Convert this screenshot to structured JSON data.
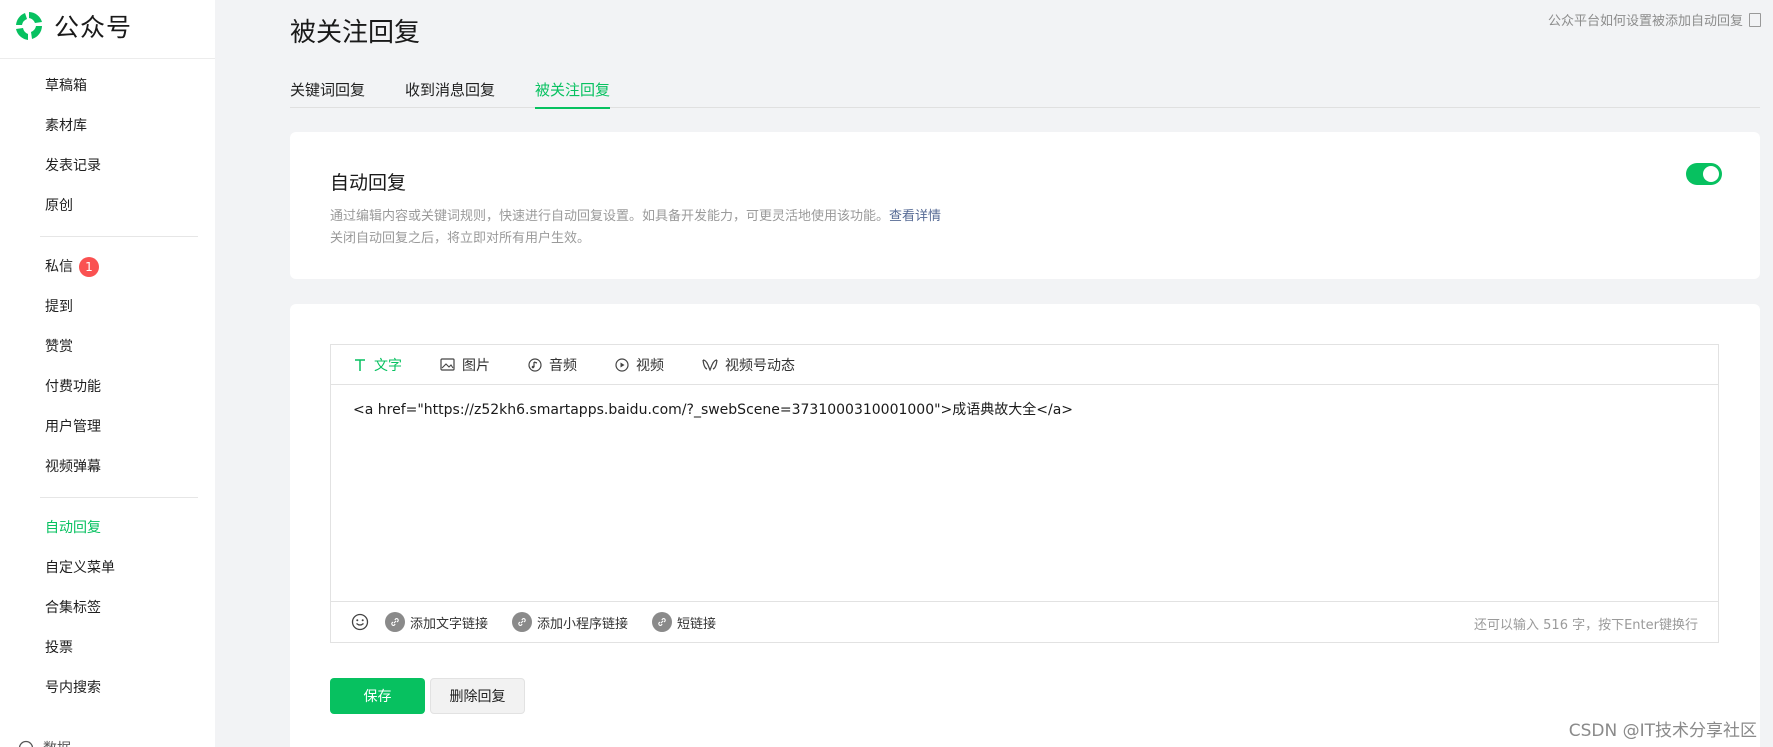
{
  "brand": {
    "name": "公众号",
    "accent": "#07c160"
  },
  "sidebar": {
    "group1": [
      {
        "label": "草稿箱"
      },
      {
        "label": "素材库"
      },
      {
        "label": "发表记录"
      },
      {
        "label": "原创"
      }
    ],
    "group2": [
      {
        "label": "私信",
        "badge": "1"
      },
      {
        "label": "提到"
      },
      {
        "label": "赞赏"
      },
      {
        "label": "付费功能"
      },
      {
        "label": "用户管理"
      },
      {
        "label": "视频弹幕"
      }
    ],
    "group3": [
      {
        "label": "自动回复",
        "active": true
      },
      {
        "label": "自定义菜单"
      },
      {
        "label": "合集标签"
      },
      {
        "label": "投票"
      },
      {
        "label": "号内搜索"
      }
    ],
    "cutoff_label": "数据"
  },
  "header": {
    "title": "被关注回复",
    "help_link": "公众平台如何设置被添加自动回复"
  },
  "tabs": [
    {
      "label": "关键词回复",
      "active": false
    },
    {
      "label": "收到消息回复",
      "active": false
    },
    {
      "label": "被关注回复",
      "active": true
    }
  ],
  "auto_reply": {
    "title": "自动回复",
    "desc_line1": "通过编辑内容或关键词规则，快速进行自动回复设置。如具备开发能力，可更灵活地使用该功能。",
    "details_link": "查看详情",
    "desc_line2": "关闭自动回复之后，将立即对所有用户生效。",
    "enabled": true
  },
  "editor": {
    "tabs": [
      {
        "label": "文字",
        "icon": "text-icon",
        "active": true
      },
      {
        "label": "图片",
        "icon": "image-icon",
        "active": false
      },
      {
        "label": "音频",
        "icon": "audio-icon",
        "active": false
      },
      {
        "label": "视频",
        "icon": "video-icon",
        "active": false
      },
      {
        "label": "视频号动态",
        "icon": "channels-icon",
        "active": false
      }
    ],
    "content": "<a href=\"https://z52kh6.smartapps.baidu.com/?_swebScene=3731000310001000\">成语典故大全</a>",
    "footer": {
      "add_text_link": "添加文字链接",
      "add_miniprogram_link": "添加小程序链接",
      "short_link": "短链接",
      "char_count": "还可以输入 516 字，按下Enter键换行"
    }
  },
  "actions": {
    "save": "保存",
    "delete": "删除回复"
  },
  "watermark": "CSDN @IT技术分享社区"
}
